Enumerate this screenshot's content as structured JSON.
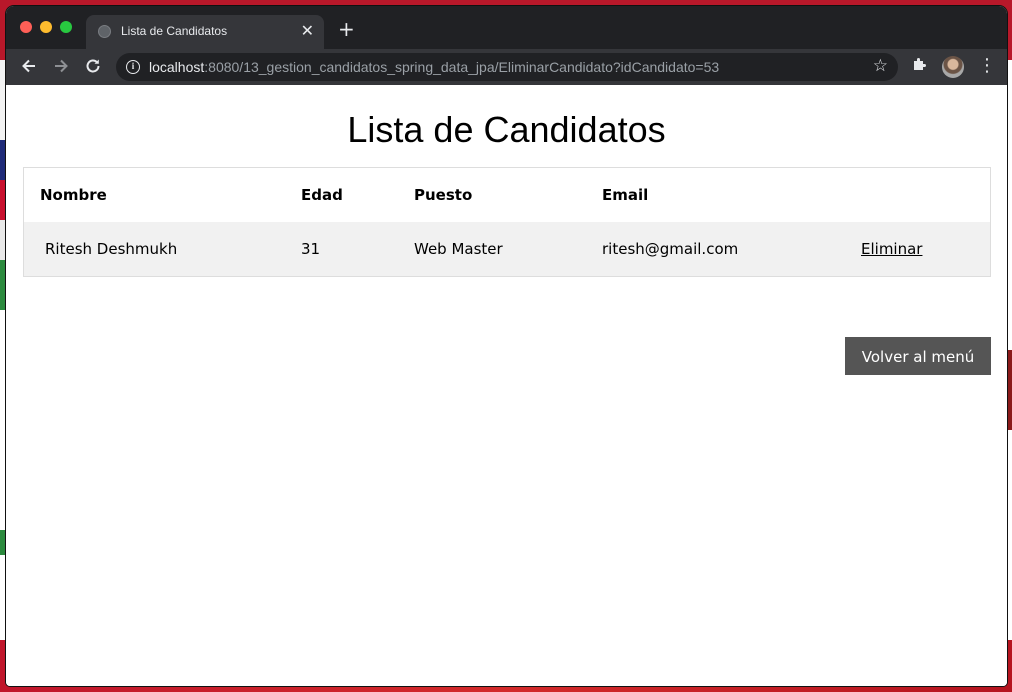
{
  "browser": {
    "tab_title": "Lista de Candidatos",
    "tab_close": "✕",
    "new_tab": "+",
    "url_host": "localhost",
    "url_rest": ":8080/13_gestion_candidatos_spring_data_jpa/EliminarCandidato?idCandidato=53"
  },
  "page": {
    "title": "Lista de Candidatos",
    "table": {
      "headers": [
        "Nombre",
        "Edad",
        "Puesto",
        "Email",
        ""
      ],
      "rows": [
        {
          "nombre": "Ritesh Deshmukh",
          "edad": "31",
          "puesto": "Web Master",
          "email": "ritesh@gmail.com",
          "action": "Eliminar"
        }
      ]
    },
    "back_button": "Volver al menú"
  }
}
